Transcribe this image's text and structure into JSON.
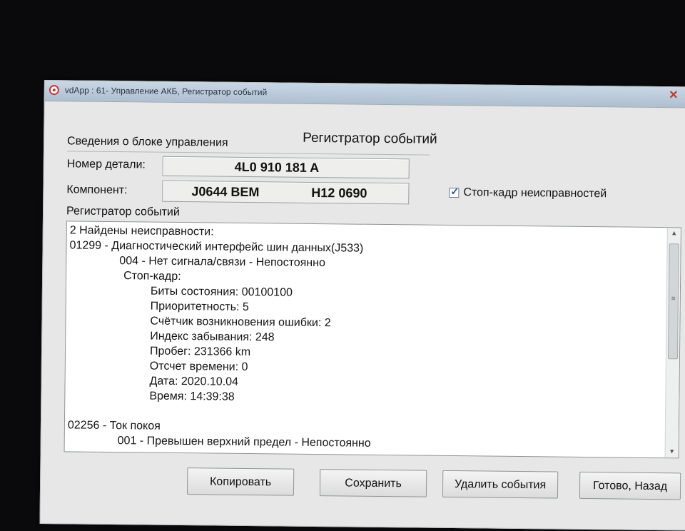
{
  "window": {
    "title": "vdApp : 61- Управление АКБ, Регистратор событий",
    "close_glyph": "✕"
  },
  "header": {
    "section_label": "Сведения о блоке управления",
    "heading": "Регистратор событий"
  },
  "fields": {
    "part_number_label": "Номер детали:",
    "part_number_value": "4L0 910 181 A",
    "component_label": "Компонент:",
    "component_code": "J0644 BEM",
    "component_version": "H12 0690"
  },
  "freeze_frame": {
    "label": "Стоп-кадр неисправностей",
    "checked": true
  },
  "log": {
    "group_label": "Регистратор событий",
    "lines": [
      {
        "indent": 0,
        "text": "2 Найдены неисправности:"
      },
      {
        "indent": 0,
        "text": "01299 - Диагностический интерфейс шин данных(J533)"
      },
      {
        "indent": 70,
        "text": "004 - Нет сигнала/связи - Непостоянно"
      },
      {
        "indent": 76,
        "text": "Стоп-кадр:"
      },
      {
        "indent": 114,
        "text": "Биты состояния: 00100100"
      },
      {
        "indent": 114,
        "text": "Приоритетность: 5"
      },
      {
        "indent": 114,
        "text": "Счётчик возникновения ошибки: 2"
      },
      {
        "indent": 114,
        "text": "Индекс забывания: 248"
      },
      {
        "indent": 114,
        "text": "Пробег: 231366 km"
      },
      {
        "indent": 114,
        "text": "Отсчет времени: 0"
      },
      {
        "indent": 114,
        "text": "Дата: 2020.10.04"
      },
      {
        "indent": 114,
        "text": "Время: 14:39:38"
      },
      {
        "indent": 0,
        "text": ""
      },
      {
        "indent": 0,
        "text": "02256 - Ток покоя"
      },
      {
        "indent": 70,
        "text": "001 - Превышен верхний предел - Непостоянно"
      }
    ]
  },
  "buttons": {
    "copy": "Копировать",
    "save": "Сохранить",
    "delete_events": "Удалить события",
    "done_back": "Готово, Назад"
  },
  "colors": {
    "window_bg": "#e6e7e6",
    "log_bg": "#ffffff",
    "checkbox_accent": "#2355aa",
    "close_red": "#c0392b"
  }
}
